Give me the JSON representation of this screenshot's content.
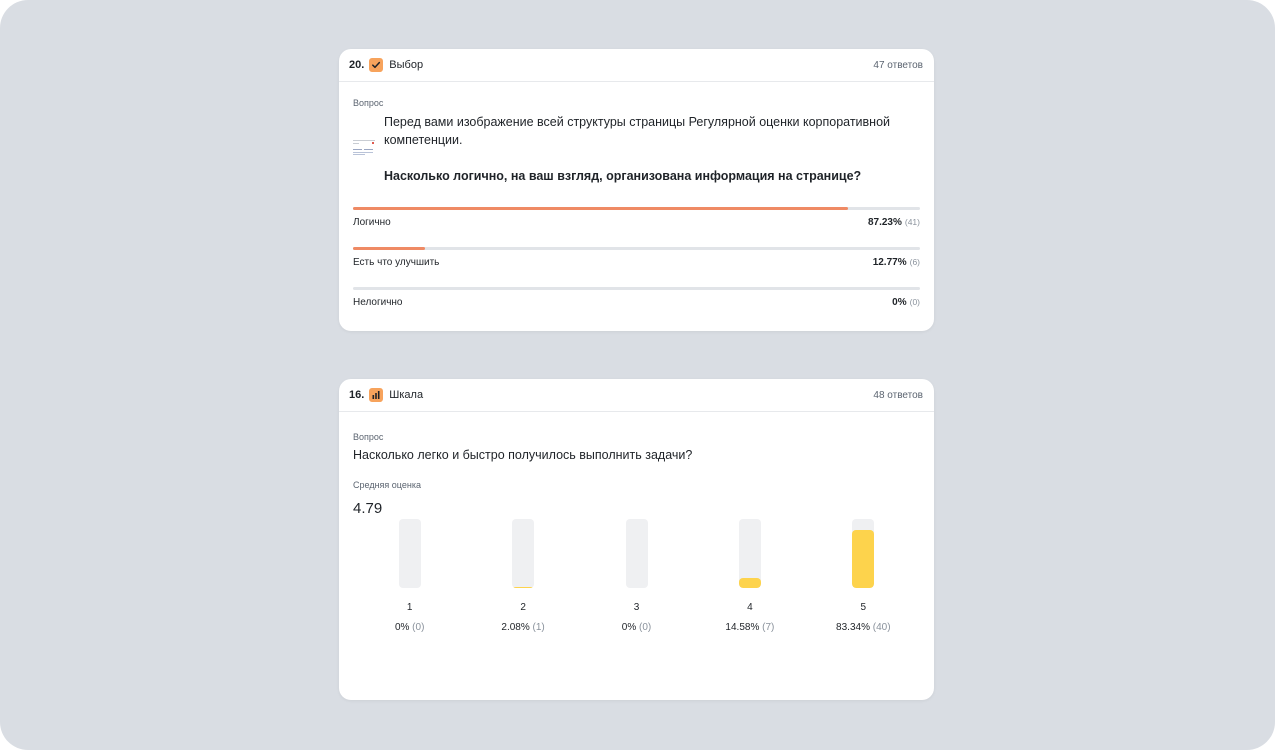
{
  "colors": {
    "background": "#d9dde3",
    "choice_fill": "#ef8a64",
    "scale_fill": "#fdd34c",
    "icon_orange": "#f7a35c"
  },
  "card_choice": {
    "number": "20.",
    "type_icon": "checkmark-icon",
    "type_label": "Выбор",
    "answers": "47 ответов",
    "question_label": "Вопрос",
    "question_text": "Перед вами изображение всей структуры страницы Регулярной оценки корпоративной компетенции.",
    "question_bold": "Насколько логично, на ваш взгляд, организована информация на странице?",
    "options": [
      {
        "label": "Логично",
        "percent": "87.23%",
        "count": "(41)",
        "fraction": 0.8723
      },
      {
        "label": "Есть что улучшить",
        "percent": "12.77%",
        "count": "(6)",
        "fraction": 0.1277
      },
      {
        "label": "Нелогично",
        "percent": "0%",
        "count": "(0)",
        "fraction": 0
      }
    ]
  },
  "card_scale": {
    "number": "16.",
    "type_icon": "bar-chart-icon",
    "type_label": "Шкала",
    "answers": "48 ответов",
    "question_label": "Вопрос",
    "question_text": "Насколько легко и быстро получилось выполнить задачи?",
    "average_label": "Средняя оценка",
    "average_value": "4.79"
  },
  "chart_data": {
    "type": "bar",
    "categories": [
      "1",
      "2",
      "3",
      "4",
      "5"
    ],
    "values": [
      0,
      2.08,
      0,
      14.58,
      83.34
    ],
    "counts": [
      0,
      1,
      0,
      7,
      40
    ],
    "percent_labels": [
      "0%",
      "2.08%",
      "0%",
      "14.58%",
      "83.34%"
    ],
    "count_labels": [
      "(0)",
      "(1)",
      "(0)",
      "(7)",
      "(40)"
    ],
    "ylim": [
      0,
      100
    ]
  }
}
